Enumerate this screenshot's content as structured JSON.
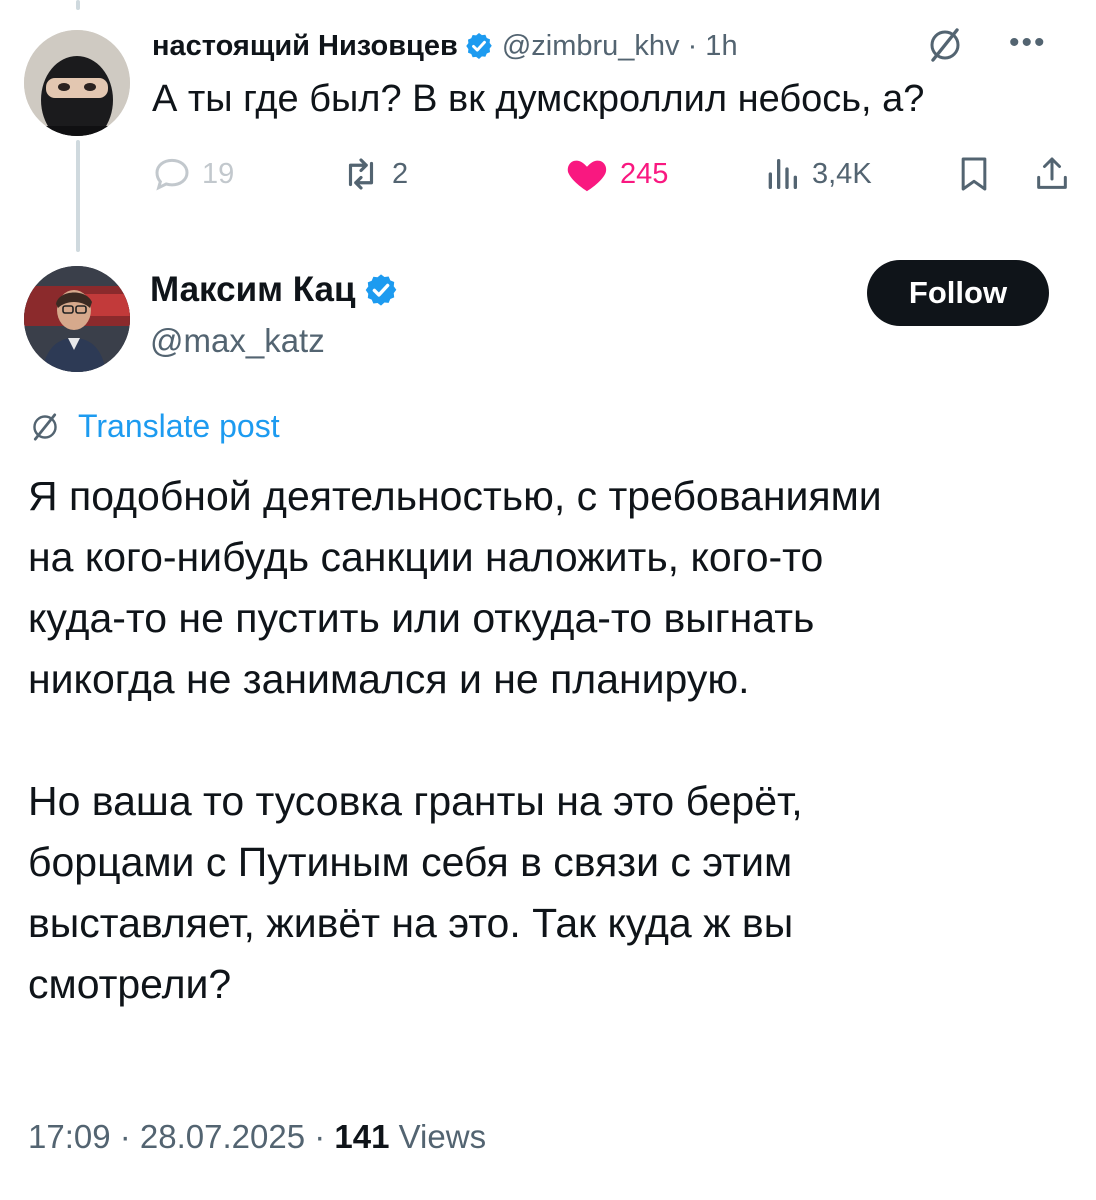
{
  "reply": {
    "author_name": "настоящий Низовцев",
    "author_handle": "@zimbru_khv · 1h",
    "text": "А ты где был? В вк думскроллил небось, а?",
    "actions": {
      "replies": "19",
      "reposts": "2",
      "likes": "245",
      "views": "3,4K"
    },
    "icons": {
      "avatar": "masked-person-avatar",
      "verified": "verified-badge-icon",
      "grok": "grok-icon",
      "more": "more-dots-icon"
    }
  },
  "main": {
    "author_name": "Максим Кац",
    "author_handle": "@max_katz",
    "follow_label": "Follow",
    "translate_label": "Translate post",
    "paragraphs": [
      {
        "lines": [
          "Я подобной деятельностью, с требованиями",
          "на кого-нибудь санкции наложить, кого-то",
          "куда-то не пустить или откуда-то выгнать",
          "никогда не занимался и не планирую."
        ]
      },
      {
        "lines": [
          "Но ваша то тусовка гранты на это берёт,",
          "борцами с Путиным себя в связи с этим",
          "выставляет, живёт на это. Так куда ж вы",
          "смотрели?"
        ]
      }
    ],
    "meta": {
      "time_date": "17:09 · 28.07.2025 · ",
      "views_count": "141",
      "views_label": " Views"
    }
  },
  "colors": {
    "text": "#0f1419",
    "secondary": "#536471",
    "accent_blue": "#1d9bf0",
    "like_pink": "#f91880",
    "thread_line": "#cfd9de"
  }
}
